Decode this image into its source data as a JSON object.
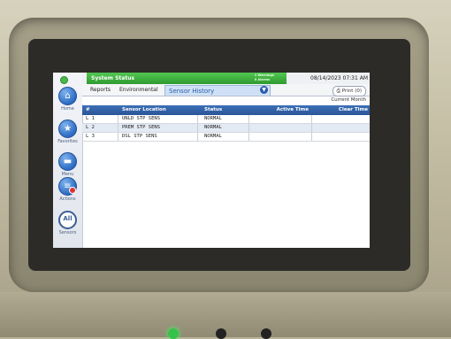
{
  "status_bar": {
    "title": "System Status",
    "alarm_counts": [
      "1 Warnings",
      "0 Alarms"
    ],
    "datetime": "08/14/2023 07:31 AM",
    "indicator_color": "#46b946"
  },
  "sidebar": {
    "items": [
      {
        "label": "Home",
        "icon": "home-icon"
      },
      {
        "label": "Favorites",
        "icon": "star-icon"
      },
      {
        "label": "Menu",
        "icon": "menu-icon"
      },
      {
        "label": "Actions",
        "icon": "actions-icon"
      },
      {
        "label": "Sensors",
        "icon": "all-sensors-icon",
        "glyph": "All"
      }
    ]
  },
  "tabs": [
    "Reports",
    "Environmental",
    "Sensor History"
  ],
  "active_tab": "Sensor History",
  "print_button": {
    "label": "Print (0)",
    "icon": "printer-icon"
  },
  "period_label": "Current Month",
  "table": {
    "columns": [
      "#",
      "Sensor Location",
      "Status",
      "Active Time",
      "Clear Time"
    ],
    "rows": [
      {
        "num": "L 1",
        "location": "UNLD STP SENS",
        "status": "NORMAL",
        "active": "",
        "clear": ""
      },
      {
        "num": "L 2",
        "location": "PREM STP SENS",
        "status": "NORMAL",
        "active": "",
        "clear": ""
      },
      {
        "num": "L 3",
        "location": "DSL STP SENS",
        "status": "NORMAL",
        "active": "",
        "clear": ""
      }
    ]
  },
  "colors": {
    "accent": "#2a5597",
    "status_green": "#3fae3f"
  }
}
